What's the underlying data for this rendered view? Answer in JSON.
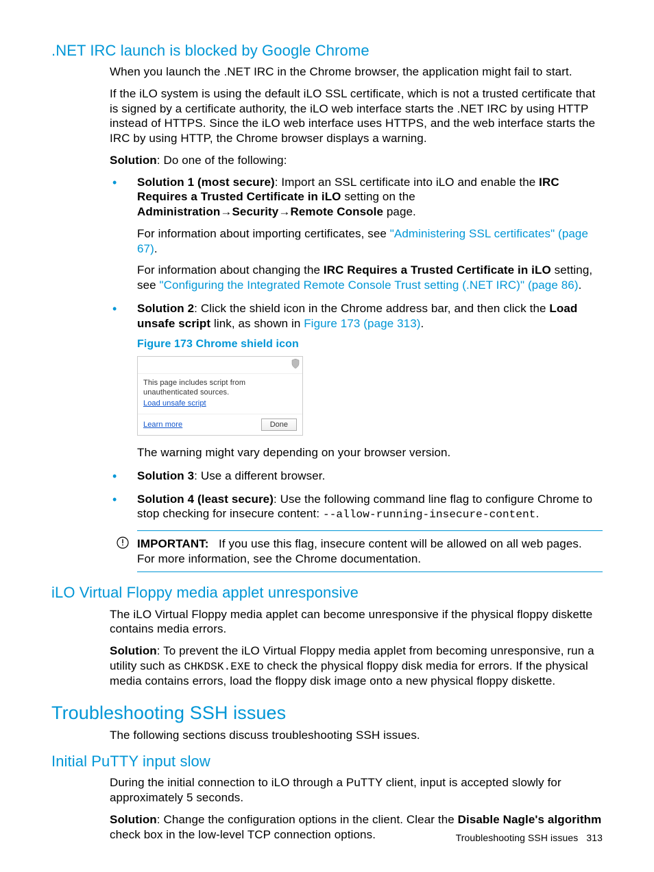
{
  "section1": {
    "heading": ".NET IRC launch is blocked by Google Chrome",
    "p1": "When you launch the .NET IRC in the Chrome browser, the application might fail to start.",
    "p2": "If the iLO system is using the default iLO SSL certificate, which is not a trusted certificate that is signed by a certificate authority, the iLO web interface starts the .NET IRC by using HTTP instead of HTTPS. Since the iLO web interface uses HTTPS, and the web interface starts the IRC by using HTTP, the Chrome browser displays a warning.",
    "solution_label": "Solution",
    "solution_intro": ": Do one of the following:",
    "sol1_label": "Solution 1 (most secure)",
    "sol1_a": ": Import an SSL certificate into iLO and enable the ",
    "sol1_b": "IRC Requires a Trusted Certificate in iLO",
    "sol1_c": " setting on the ",
    "sol1_nav1": "Administration",
    "sol1_nav2": "Security",
    "sol1_nav3": "Remote Console",
    "sol1_d": " page.",
    "sol1_info1a": "For information about importing certificates, see ",
    "sol1_link1": "\"Administering SSL certificates\" (page 67)",
    "sol1_info2a": "For information about changing the ",
    "sol1_info2b": "IRC Requires a Trusted Certificate in iLO",
    "sol1_info2c": " setting, see ",
    "sol1_link2": "\"Configuring the Integrated Remote Console Trust setting (.NET IRC)\" (page 86)",
    "sol2_label": "Solution 2",
    "sol2_a": ": Click the shield icon in the Chrome address bar, and then click the ",
    "sol2_b": "Load unsafe script",
    "sol2_c": " link, as shown in ",
    "sol2_link": "Figure 173 (page 313)",
    "fig_caption": "Figure 173 Chrome shield icon",
    "popup_msg": "This page includes script from unauthenticated sources.",
    "popup_load": "Load unsafe script",
    "popup_learn": "Learn more",
    "popup_done": "Done",
    "after_fig": "The warning might vary depending on your browser version.",
    "sol3_label": "Solution 3",
    "sol3_text": ": Use a different browser.",
    "sol4_label": "Solution 4 (least secure)",
    "sol4_a": ": Use the following command line flag to configure Chrome to stop checking for insecure content: ",
    "sol4_code": "--allow-running-insecure-content",
    "important_label": "IMPORTANT:",
    "important_text": "If you use this flag, insecure content will be allowed on all web pages. For more information, see the Chrome documentation."
  },
  "section2": {
    "heading": "iLO Virtual Floppy media applet unresponsive",
    "p1": "The iLO Virtual Floppy media applet can become unresponsive if the physical floppy diskette contains media errors.",
    "sol_label": "Solution",
    "sol_a": ": To prevent the iLO Virtual Floppy media applet from becoming unresponsive, run a utility such as ",
    "sol_code": "CHKDSK.EXE",
    "sol_b": " to check the physical floppy disk media for errors. If the physical media contains errors, load the floppy disk image onto a new physical floppy diskette."
  },
  "section3": {
    "heading": "Troubleshooting SSH issues",
    "p1": "The following sections discuss troubleshooting SSH issues."
  },
  "section4": {
    "heading": "Initial PuTTY input slow",
    "p1": "During the initial connection to iLO through a PuTTY client, input is accepted slowly for approximately 5 seconds.",
    "sol_label": "Solution",
    "sol_a": ": Change the configuration options in the client. Clear the ",
    "sol_b": "Disable Nagle's algorithm",
    "sol_c": " check box in the low-level TCP connection options."
  },
  "footer": {
    "text": "Troubleshooting SSH issues",
    "page": "313"
  }
}
